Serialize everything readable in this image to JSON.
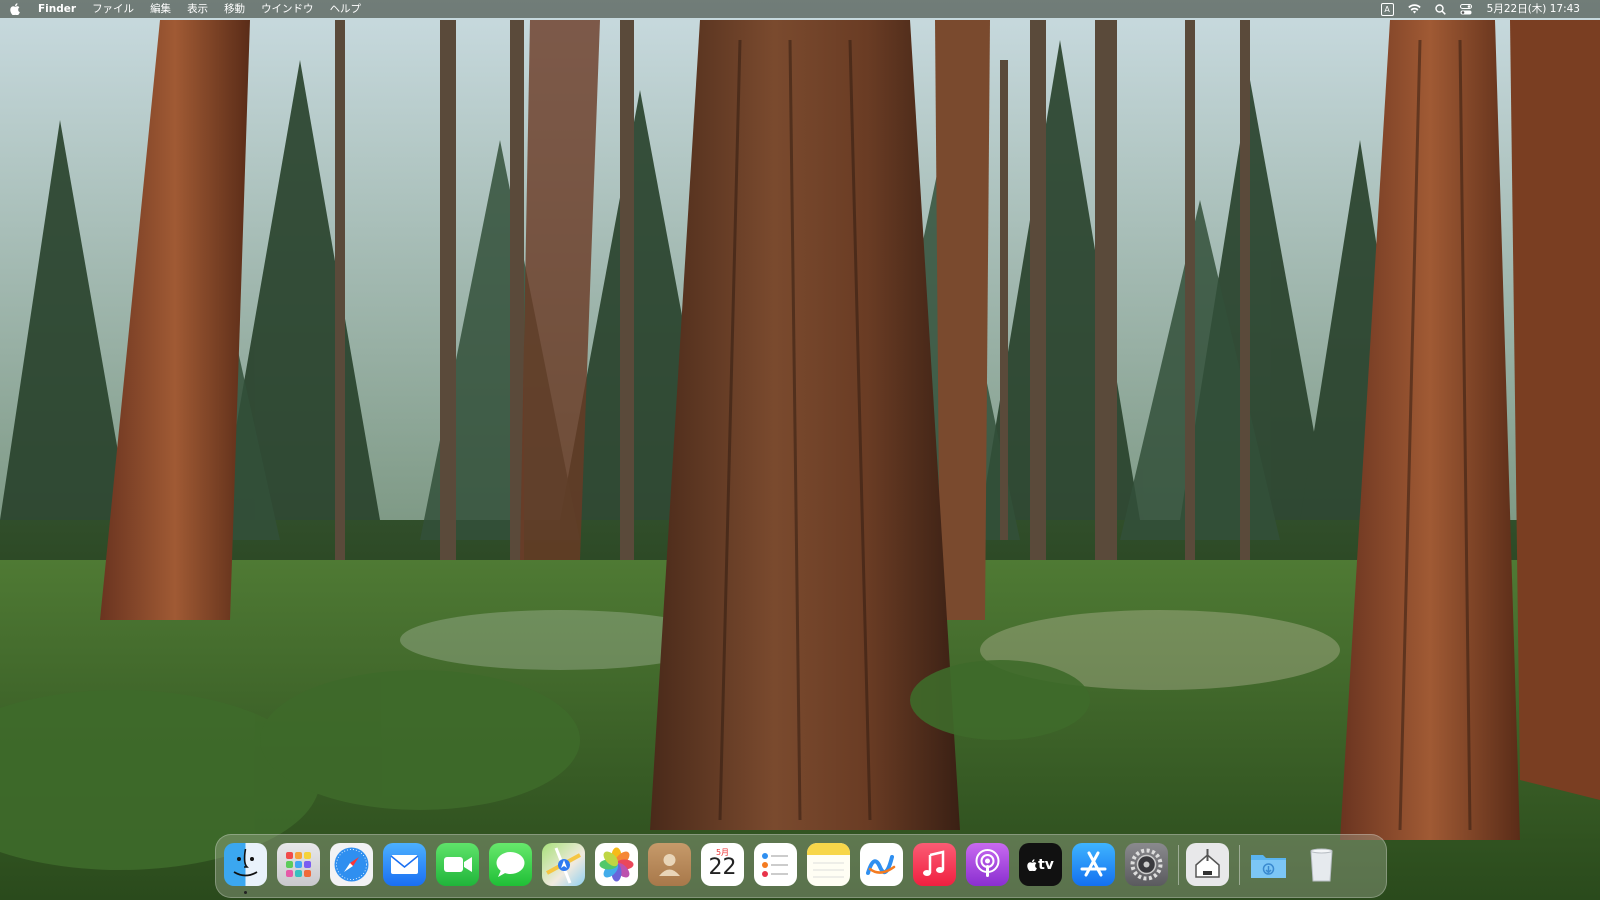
{
  "menubar": {
    "apple_icon": "apple-logo-icon",
    "app_name": "Finder",
    "menus": [
      "ファイル",
      "編集",
      "表示",
      "移動",
      "ウインドウ",
      "ヘルプ"
    ],
    "input_source": "A",
    "datetime": "5月22日(木) 17:43"
  },
  "dock": {
    "apps": [
      {
        "name": "Finder",
        "icon": "finder-icon",
        "running": true
      },
      {
        "name": "Launchpad",
        "icon": "launchpad-icon"
      },
      {
        "name": "Safari",
        "icon": "safari-icon"
      },
      {
        "name": "Mail",
        "icon": "mail-icon"
      },
      {
        "name": "FaceTime",
        "icon": "facetime-icon"
      },
      {
        "name": "Messages",
        "icon": "messages-icon"
      },
      {
        "name": "Maps",
        "icon": "maps-icon"
      },
      {
        "name": "Photos",
        "icon": "photos-icon"
      },
      {
        "name": "Contacts",
        "icon": "contacts-icon"
      },
      {
        "name": "Calendar",
        "icon": "calendar-icon"
      },
      {
        "name": "Reminders",
        "icon": "reminders-icon"
      },
      {
        "name": "Notes",
        "icon": "notes-icon"
      },
      {
        "name": "Freeform",
        "icon": "freeform-icon"
      },
      {
        "name": "Music",
        "icon": "music-icon"
      },
      {
        "name": "Podcasts",
        "icon": "podcasts-icon"
      },
      {
        "name": "TV",
        "icon": "tv-icon"
      },
      {
        "name": "App Store",
        "icon": "app-store-icon"
      },
      {
        "name": "System Settings",
        "icon": "system-settings-icon"
      },
      {
        "name": "Installer",
        "icon": "installer-icon"
      },
      {
        "name": "Downloads",
        "icon": "downloads-folder-icon"
      },
      {
        "name": "Trash",
        "icon": "trash-icon"
      }
    ],
    "calendar": {
      "month": "5月",
      "day": "22"
    },
    "tv_label": "tv"
  }
}
